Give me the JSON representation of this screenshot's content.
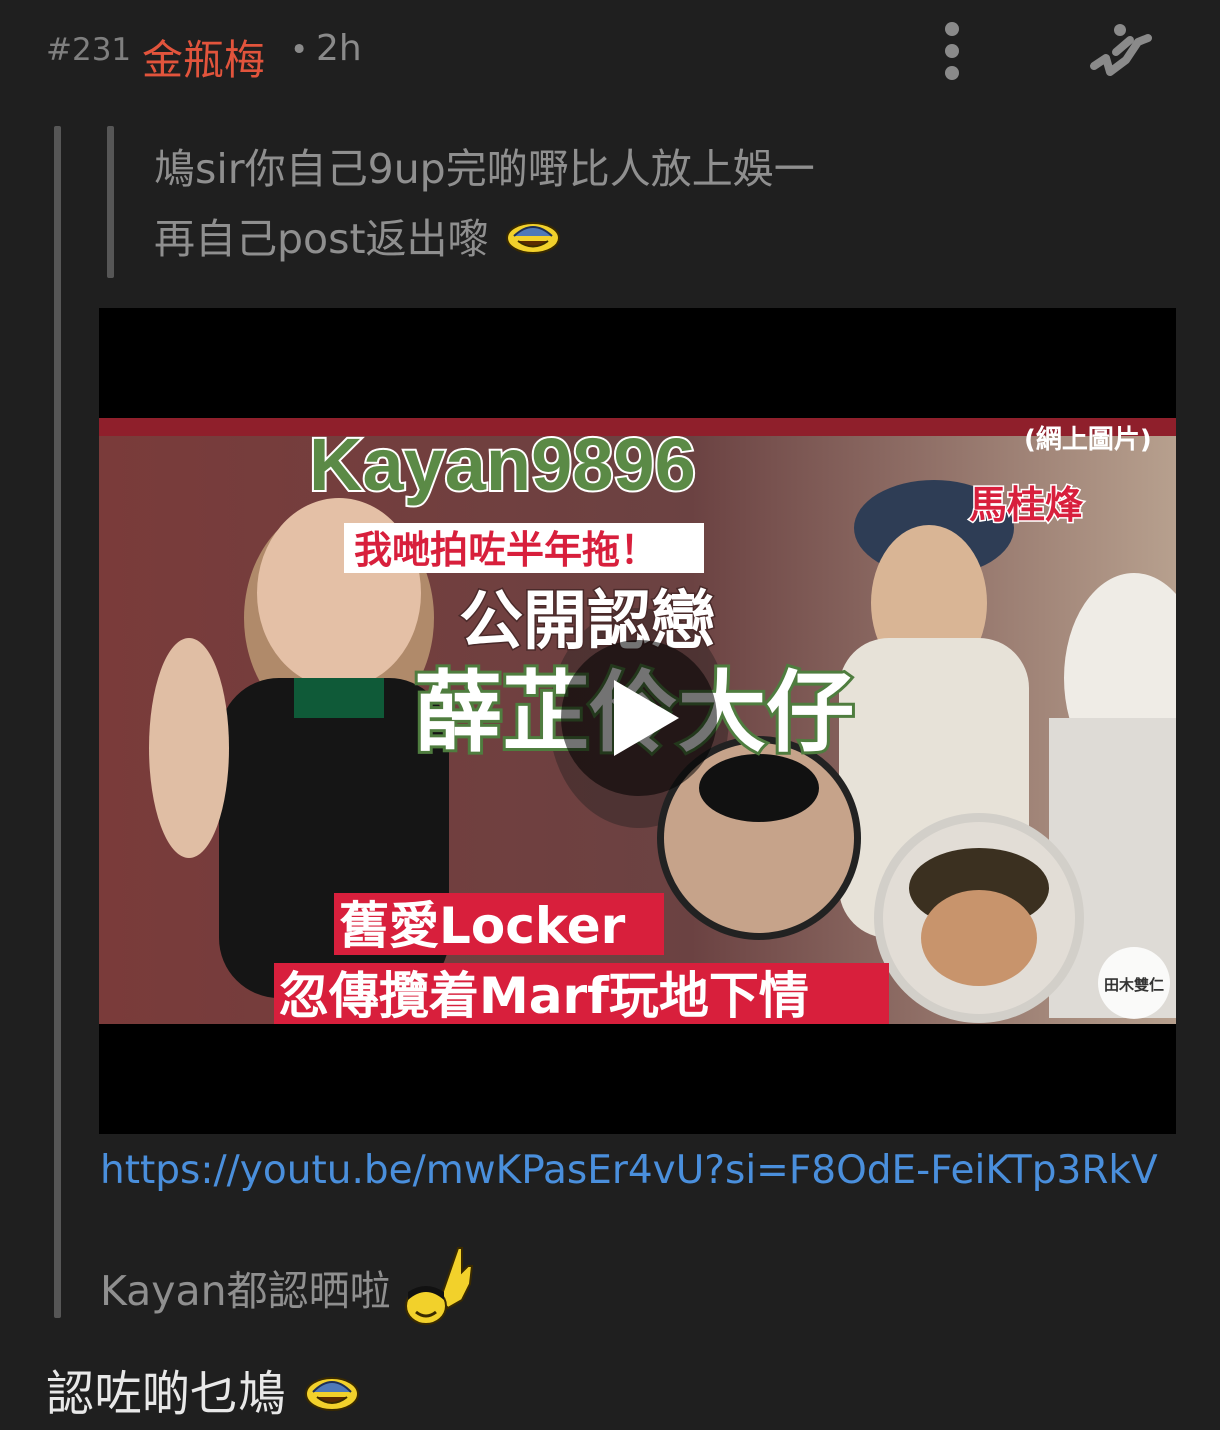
{
  "post": {
    "number": "#231",
    "username": "金瓶梅",
    "dot": "•",
    "time": "2h"
  },
  "inner_quote": {
    "line1": "鳩sir你自己9up完啲嘢比人放上娛一",
    "line2": "再自己post返出嚟"
  },
  "video": {
    "channel_text": "Kayan9896",
    "source_tag": "(網上圖片)",
    "name_tag": "馬桂烽",
    "subtitle": "我哋拍咗半年拖！",
    "headline1": "公開認戀",
    "headline2": "薛芷伶大仔",
    "banner1": "舊愛Locker",
    "banner2": "忽傳攬着Marf玩地下情",
    "watermark": "田木雙仁",
    "colors": {
      "headline": "#4f7d3f",
      "banner": "#d81f3c",
      "background": "#7a3f3f"
    }
  },
  "link": "https://youtu.be/mwKPasEr4vU?si=F8OdE-FeiKTp3RkV",
  "outer_quote_text": "Kayan都認晒啦",
  "reply_text": "認咗啲乜鳩",
  "colors": {
    "background": "#1f1f1f",
    "username": "#e2543c",
    "link": "#4a8fdc",
    "quote_text": "#8f8f8f"
  }
}
